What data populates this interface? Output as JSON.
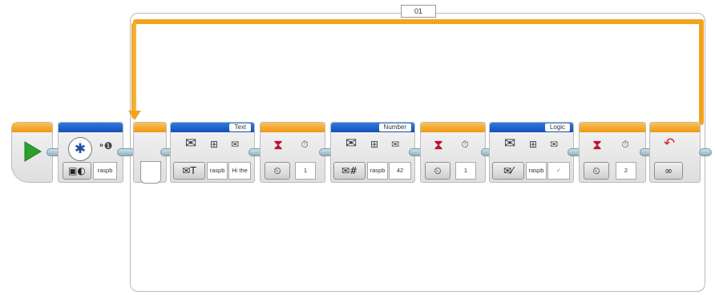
{
  "loop": {
    "label": "01",
    "mode_icon": "infinity-icon",
    "mode_symbol": "∞"
  },
  "blocks": {
    "text_send": {
      "title": "Text",
      "mailbox": "raspb",
      "value": "Hi the"
    },
    "number_send": {
      "title": "Number",
      "mailbox": "raspb",
      "value": "42"
    },
    "logic_send": {
      "title": "Logic",
      "mailbox": "raspb",
      "value": "✓"
    },
    "bluetooth": {
      "port": "raspb"
    },
    "wait1": {
      "seconds": "1"
    },
    "wait2": {
      "seconds": "1"
    },
    "wait3": {
      "seconds": "2"
    }
  },
  "colors": {
    "flow": "#f2a41f",
    "action_bar": "#1a5fcb",
    "start": "#2aa12a"
  }
}
